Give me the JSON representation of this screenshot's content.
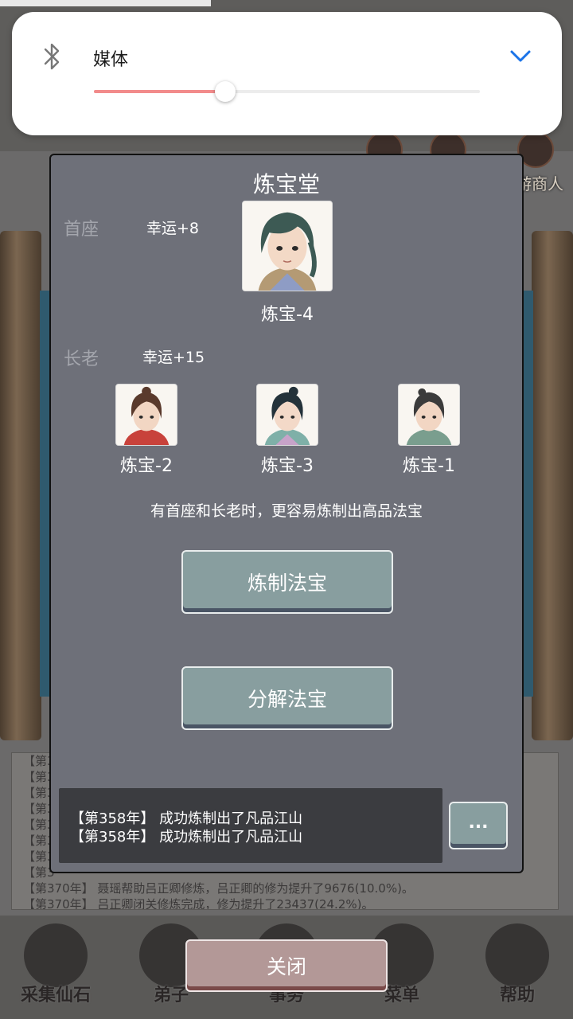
{
  "volume_panel": {
    "label": "媒体",
    "level": 0.34,
    "accent": "#f28b8b"
  },
  "background": {
    "merchant_label": "游商人",
    "log_lines": [
      "【第3",
      "【第3",
      "【第3",
      "【第3",
      "【第3",
      "【第3",
      "【第3",
      "【第3",
      "【第370年】 聂瑶帮助吕正卿修炼，吕正卿的修为提升了9676(10.0%)。",
      "【第370年】 吕正卿闭关修炼完成，修为提升了23437(24.2%)。"
    ],
    "nav": [
      "采集仙石",
      "弟子",
      "事务",
      "菜单",
      "帮助"
    ]
  },
  "dialog": {
    "title": "炼宝堂",
    "chief": {
      "label": "首座",
      "bonus": "幸运+8",
      "name": "炼宝-4"
    },
    "elders": {
      "label": "长老",
      "bonus": "幸运+15",
      "members": [
        "炼宝-2",
        "炼宝-3",
        "炼宝-1"
      ]
    },
    "hint": "有首座和长老时，更容易炼制出高品法宝",
    "refine_button": "炼制法宝",
    "decompose_button": "分解法宝",
    "messages": [
      "【第358年】 成功炼制出了凡品江山",
      "【第358年】 成功炼制出了凡品江山"
    ],
    "more_button": "..."
  },
  "close_button": "关闭"
}
